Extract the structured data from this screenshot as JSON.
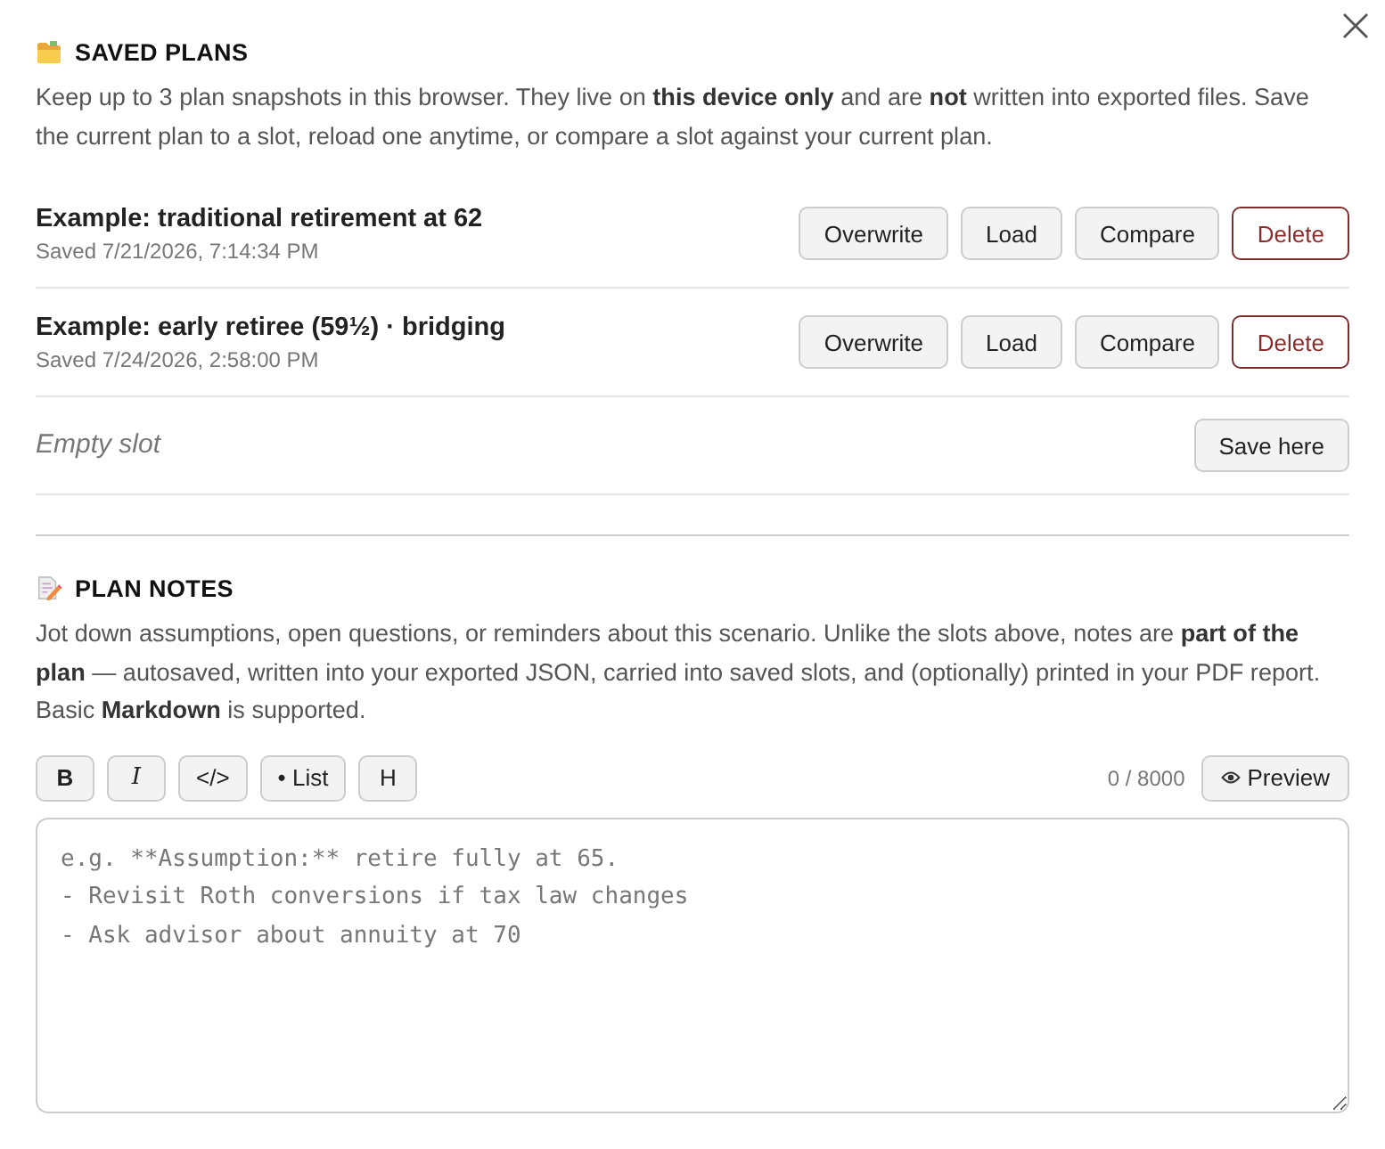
{
  "saved_plans": {
    "title": "SAVED PLANS",
    "description": "Keep up to 3 plan snapshots in this browser. They live on **this device only** and are **not** written into exported files. Save the current plan to a slot, reload one anytime, or compare a slot against your current plan.",
    "slots": [
      {
        "kind": "saved",
        "name": "Example: traditional retirement at 62",
        "saved": "Saved 7/21/2026, 7:14:34 PM",
        "actions": [
          {
            "label": "Overwrite",
            "kind": "normal"
          },
          {
            "label": "Load",
            "kind": "normal"
          },
          {
            "label": "Compare",
            "kind": "normal"
          },
          {
            "label": "Delete",
            "kind": "danger"
          }
        ]
      },
      {
        "kind": "saved",
        "name": "Example: early retiree (59½) · bridging",
        "saved": "Saved 7/24/2026, 2:58:00 PM",
        "actions": [
          {
            "label": "Overwrite",
            "kind": "normal"
          },
          {
            "label": "Load",
            "kind": "normal"
          },
          {
            "label": "Compare",
            "kind": "normal"
          },
          {
            "label": "Delete",
            "kind": "danger"
          }
        ]
      },
      {
        "kind": "empty",
        "name": "Empty slot",
        "actions": [
          {
            "label": "Save here",
            "kind": "normal"
          }
        ]
      }
    ]
  },
  "plan_notes": {
    "title": "PLAN NOTES",
    "description": "Jot down assumptions, open questions, or reminders about this scenario. Unlike the slots above, notes are **part of the plan** — autosaved, written into your exported JSON, carried into saved slots, and (optionally) printed in your PDF report. Basic **Markdown** is supported.",
    "toolbar": [
      {
        "label": "B",
        "kind": "bold"
      },
      {
        "label": "I",
        "kind": "italic"
      },
      {
        "label": "</>",
        "kind": "plain"
      },
      {
        "label": "• List",
        "kind": "plain"
      },
      {
        "label": "H",
        "kind": "plain"
      }
    ],
    "count": "0 / 8000",
    "preview": {
      "label": "Preview"
    },
    "notes": {
      "placeholder": "e.g. **Assumption:** retire fully at 65.\n- Revisit Roth conversions if tax law changes\n- Ask advisor about annuity at 70"
    }
  }
}
